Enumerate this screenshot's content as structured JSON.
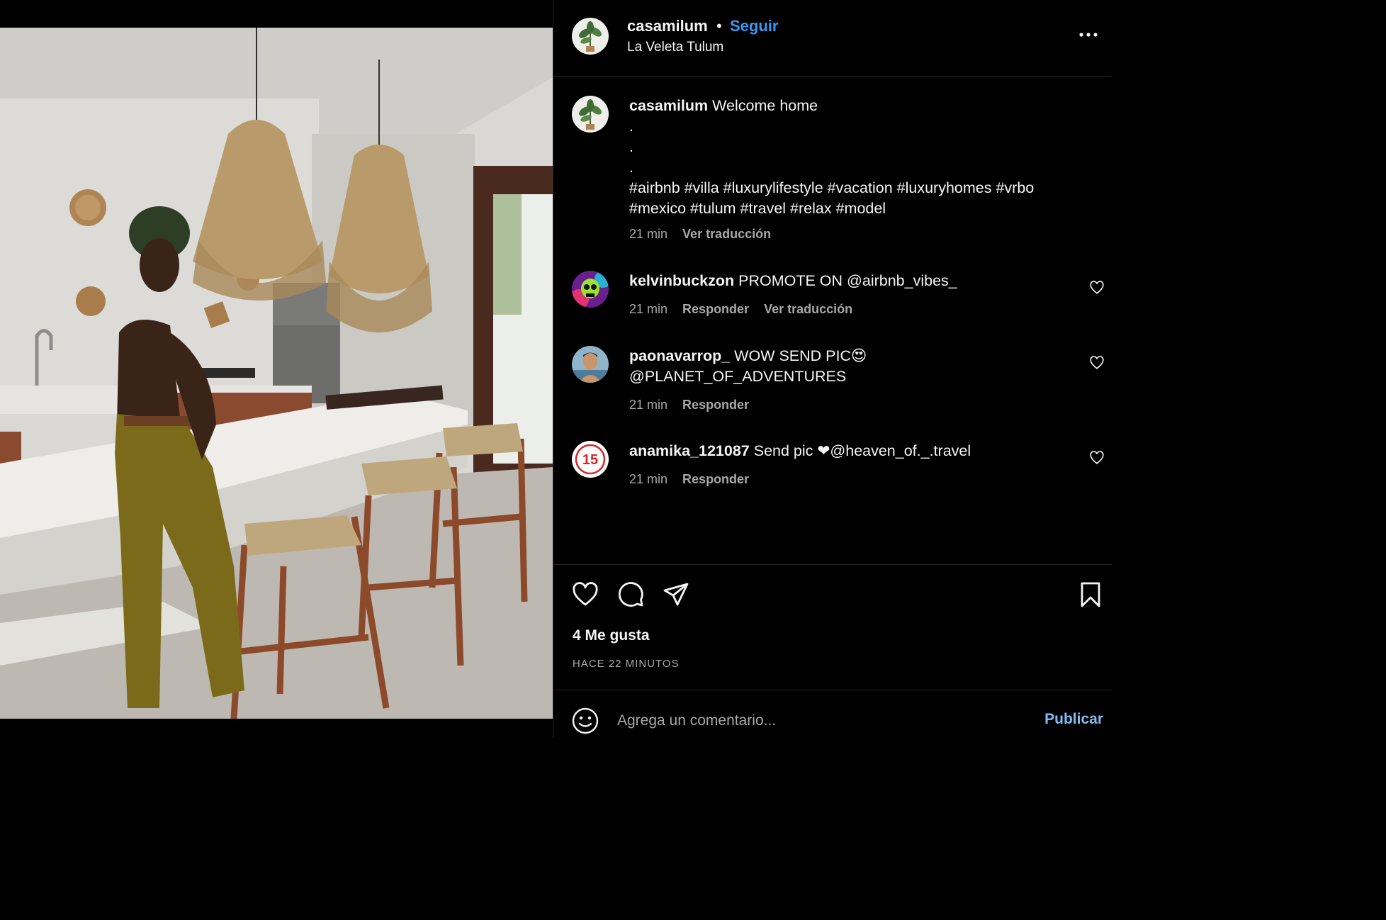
{
  "post": {
    "username": "casamilum",
    "separator": "•",
    "follow_label": "Seguir",
    "location": "La Veleta Tulum",
    "more_icon": "more-horizontal-icon"
  },
  "caption": {
    "username": "casamilum",
    "text": "Welcome home",
    "dot_lines": [
      ".",
      ".",
      "."
    ],
    "hashtags_line1": "#airbnb #villa #luxurylifestyle #vacation #luxuryhomes #vrbo",
    "hashtags_line2": "#mexico #tulum #travel #relax #model",
    "time": "21 min",
    "translate_label": "Ver traducción"
  },
  "comments": [
    {
      "username": "kelvinbuckzon",
      "text": "PROMOTE ON @airbnb_vibes_",
      "time": "21 min",
      "reply_label": "Responder",
      "translate_label": "Ver traducción"
    },
    {
      "username": "paonavarrop_",
      "text": "WOW SEND PIC😍 @PLANET_OF_ADVENTURES",
      "time": "21 min",
      "reply_label": "Responder"
    },
    {
      "username": "anamika_121087",
      "text": "Send pic ❤@heaven_of._.travel",
      "avatar_badge": "15",
      "time": "21 min",
      "reply_label": "Responder"
    }
  ],
  "actions": {
    "icons": [
      "heart-icon",
      "comment-icon",
      "share-icon",
      "bookmark-icon"
    ],
    "likes": "4 Me gusta",
    "posted": "HACE 22 MINUTOS"
  },
  "composer": {
    "placeholder": "Agrega un comentario...",
    "publish_label": "Publicar"
  },
  "colors": {
    "background": "#000000",
    "link_blue": "#3797f0",
    "publish_blue": "#84bdf5",
    "muted": "#a8a8a8",
    "divider": "#262626"
  }
}
